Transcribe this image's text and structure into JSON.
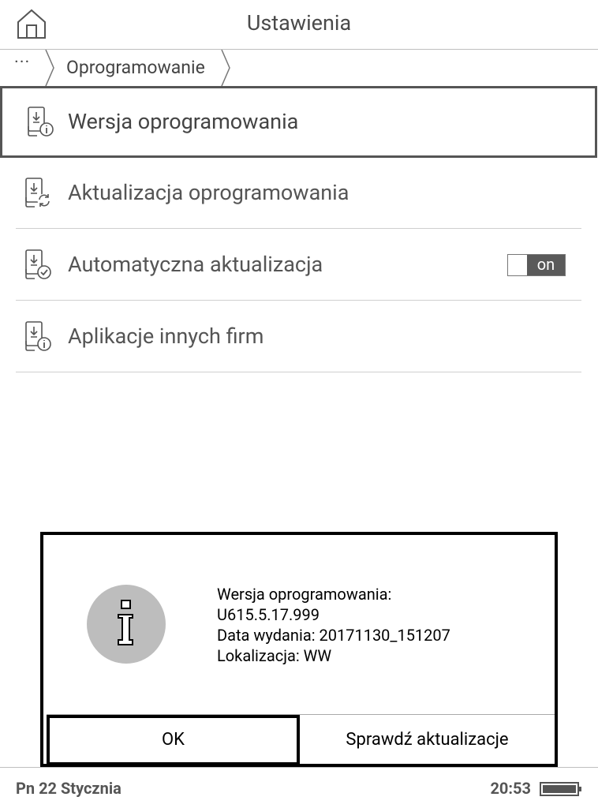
{
  "header": {
    "title": "Ustawienia",
    "home_icon": "home-icon"
  },
  "breadcrumb": {
    "more": "···",
    "current": "Oprogramowanie"
  },
  "settings_list": [
    {
      "label": "Wersja oprogramowania",
      "icon": "firmware-info-icon",
      "selected": true
    },
    {
      "label": "Aktualizacja oprogramowania",
      "icon": "firmware-update-icon"
    },
    {
      "label": "Automatyczna aktualizacja",
      "icon": "firmware-auto-update-icon",
      "toggle": "on"
    },
    {
      "label": "Aplikacje innych firm",
      "icon": "third-party-apps-icon"
    }
  ],
  "dialog": {
    "icon": "info-icon",
    "lines": [
      "Wersja oprogramowania:",
      "U615.5.17.999",
      "Data wydania: 20171130_151207",
      "Lokalizacja: WW"
    ],
    "ok_label": "OK",
    "check_label": "Sprawdź aktualizacje"
  },
  "status_bar": {
    "date": "Pn 22 Stycznia",
    "time": "20:53",
    "battery_icon": "battery-icon",
    "battery_level": 1.0
  },
  "colors": {
    "toggle_on_bg": "#5a5a5a",
    "info_circle": "#bdbdbd",
    "text_gray": "#555555"
  }
}
